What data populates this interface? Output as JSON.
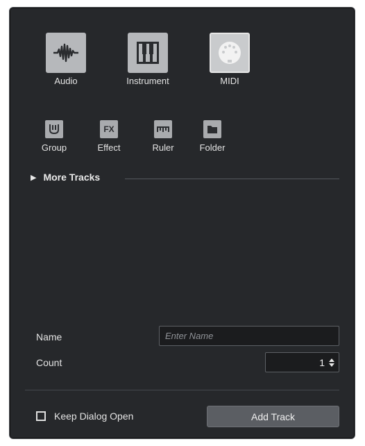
{
  "track_types": {
    "main": [
      {
        "label": "Audio",
        "icon": "audio-waveform-icon",
        "active": false
      },
      {
        "label": "Instrument",
        "icon": "piano-keys-icon",
        "active": false
      },
      {
        "label": "MIDI",
        "icon": "midi-connector-icon",
        "active": true
      }
    ],
    "secondary": [
      {
        "label": "Group",
        "icon": "group-fader-icon",
        "glyph": ""
      },
      {
        "label": "Effect",
        "icon": "fx-icon",
        "glyph": "FX"
      },
      {
        "label": "Ruler",
        "icon": "ruler-icon",
        "glyph": ""
      },
      {
        "label": "Folder",
        "icon": "folder-icon",
        "glyph": ""
      }
    ]
  },
  "more_tracks": {
    "label": "More Tracks"
  },
  "form": {
    "name_label": "Name",
    "name_placeholder": "Enter Name",
    "name_value": "",
    "count_label": "Count",
    "count_value": "1"
  },
  "footer": {
    "keep_open_label": "Keep Dialog Open",
    "keep_open_checked": false,
    "add_track_label": "Add Track"
  },
  "colors": {
    "dialog_bg": "#26282b",
    "button_bg": "#5b5e63",
    "icon_tile": "#b6b8bb"
  }
}
